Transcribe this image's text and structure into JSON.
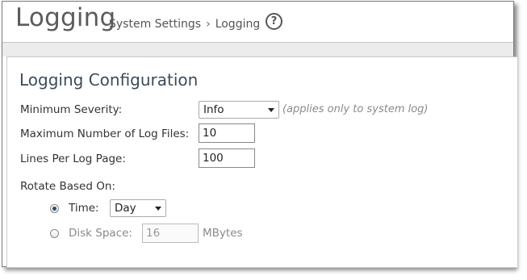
{
  "header": {
    "title": "Logging",
    "breadcrumb": {
      "parent": "System Settings",
      "separator": "›",
      "current": "Logging"
    },
    "help_icon": "?"
  },
  "panel": {
    "title": "Logging Configuration",
    "min_severity": {
      "label": "Minimum Severity:",
      "value": "Info",
      "hint": "(applies only to system log)"
    },
    "max_log_files": {
      "label": "Maximum Number of Log Files:",
      "value": "10"
    },
    "lines_per_page": {
      "label": "Lines Per Log Page:",
      "value": "100"
    },
    "rotate": {
      "label": "Rotate Based On:",
      "time": {
        "label": "Time:",
        "value": "Day",
        "selected": true
      },
      "disk_space": {
        "label": "Disk Space:",
        "value": "16",
        "unit": "MBytes",
        "selected": false
      }
    }
  }
}
